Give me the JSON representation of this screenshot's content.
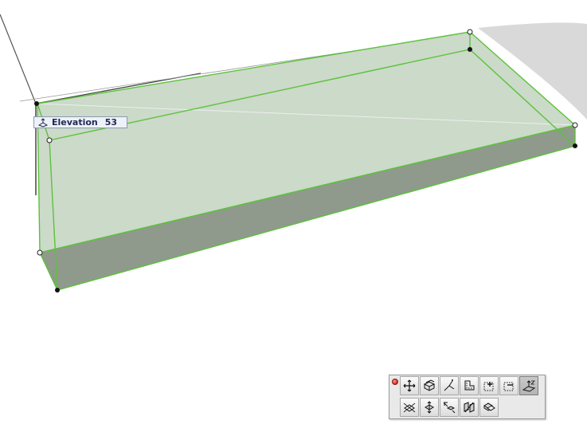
{
  "tooltip": {
    "label": "Elevation",
    "value": "53",
    "icon": "elevation-icon"
  },
  "palette": {
    "close_icon": "close-icon",
    "row1": [
      "move-icon",
      "extrude-icon",
      "drag-pivot-icon",
      "offset-icon",
      "add-point-icon",
      "subtract-icon",
      "elevation-edit-icon"
    ],
    "row2": [
      "rotate-icon",
      "mirror-icon",
      "multiply-icon",
      "split-icon",
      "stretch-icon"
    ],
    "active": "elevation-edit-icon"
  },
  "colors": {
    "selection_green": "#5cc23a",
    "slab_fill": "#c8d8c6",
    "slab_side": "#8f9a8c",
    "ground": "#d9d9d9"
  }
}
